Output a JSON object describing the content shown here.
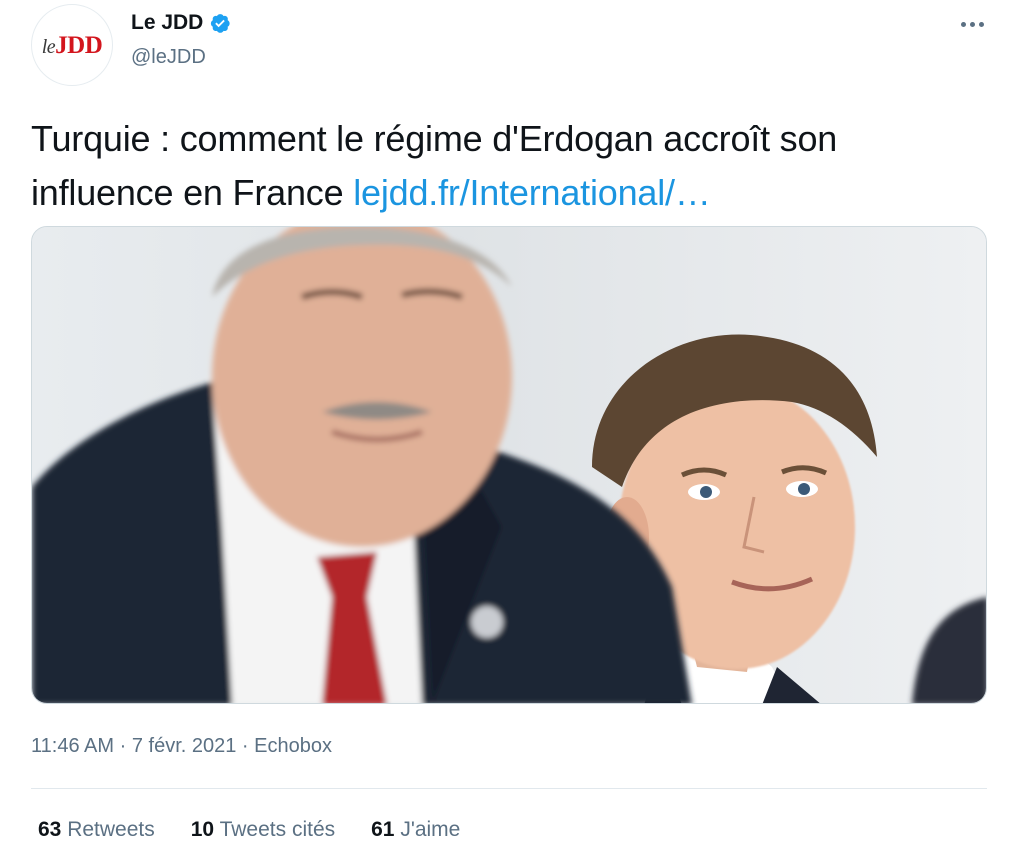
{
  "author": {
    "name": "Le JDD",
    "handle": "@leJDD",
    "logo_le": "le",
    "logo_jdd": "JDD",
    "logo_color": "#d3151d"
  },
  "tweet": {
    "text": "Turquie : comment le régime d'Erdogan accroît son influence en France",
    "link": "lejdd.fr/International/…",
    "link_color": "#1b95e0"
  },
  "meta": {
    "time": "11:46 AM",
    "date": "7 févr. 2021",
    "separator": "·",
    "source": "Echobox"
  },
  "stats": {
    "retweets_count": "63",
    "retweets_label": "Retweets",
    "quotes_count": "10",
    "quotes_label": "Tweets cités",
    "likes_count": "61",
    "likes_label": "J'aime"
  },
  "icons": {
    "verified": "verified-badge-icon",
    "more": "more-options-icon"
  }
}
